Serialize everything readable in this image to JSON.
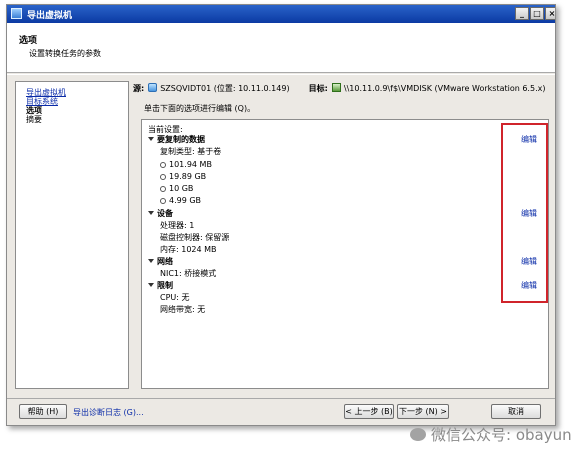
{
  "window": {
    "title": "导出虚拟机",
    "controls": {
      "minimize": "_",
      "maximize": "□",
      "close": "×"
    }
  },
  "header": {
    "title": "选项",
    "subtitle": "设置转换任务的参数"
  },
  "nav": {
    "items": [
      {
        "label": "导出虚拟机",
        "state": "link"
      },
      {
        "label": "目标系统",
        "state": "link"
      },
      {
        "label": "选项",
        "state": "current"
      },
      {
        "label": "摘要",
        "state": "plain"
      }
    ]
  },
  "source": {
    "label": "源:",
    "value": "SZSQVIDT01 (位置: 10.11.0.149)",
    "icon": "vm-icon"
  },
  "target": {
    "label": "目标:",
    "value": "\\\\10.11.0.9\\f$\\VMDISK (VMware Workstation 6.5.x)",
    "icon": "vmware-icon"
  },
  "instruction": "单击下面的选项进行编辑 (Q)。",
  "settings": {
    "current_label": "当前设置:",
    "edit_label": "编辑",
    "sections": [
      {
        "title": "要复制的数据",
        "lines": [
          "复制类型: 基于卷"
        ],
        "volumes": [
          "101.94 MB",
          "19.89 GB",
          "10 GB",
          "4.99 GB"
        ]
      },
      {
        "title": "设备",
        "lines": [
          "处理器: 1",
          "磁盘控制器: 保留源",
          "内存: 1024 MB"
        ]
      },
      {
        "title": "网络",
        "lines": [
          "NIC1: 桥接模式"
        ]
      },
      {
        "title": "限制",
        "lines": [
          "CPU: 无",
          "网络带宽: 无"
        ]
      }
    ]
  },
  "footer": {
    "help": "帮助 (H)",
    "diagnostics": "导出诊断日志 (G)...",
    "back": "< 上一步 (B)",
    "next": "下一步 (N) >",
    "cancel": "取消"
  },
  "watermark": "微信公众号: obayun",
  "colors": {
    "titlebar": "#0b3aa3",
    "link": "#0a2ba8",
    "highlight_box": "#d0242b"
  }
}
